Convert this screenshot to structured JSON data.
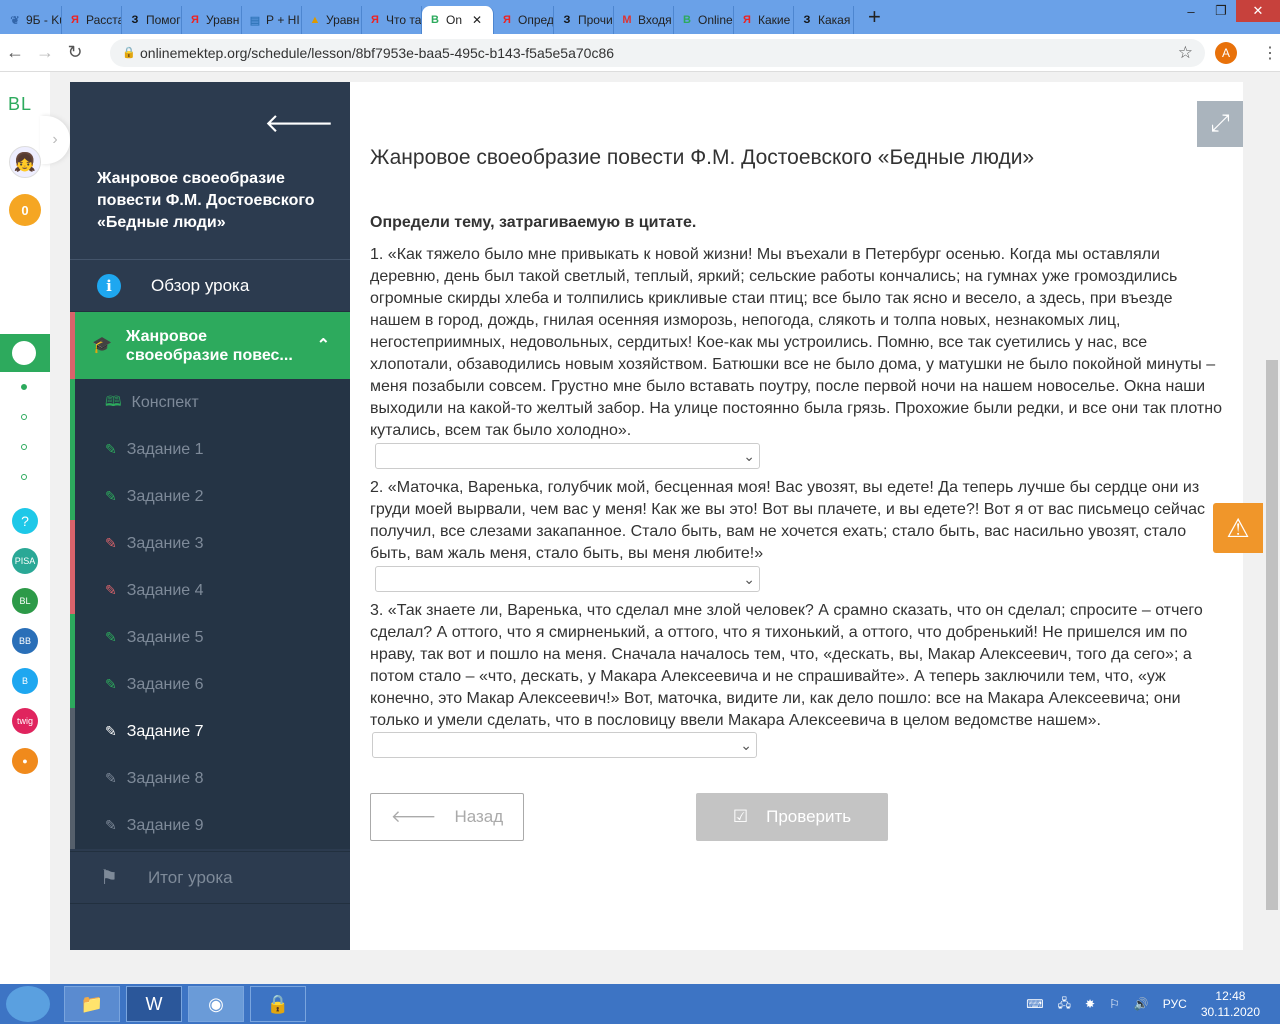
{
  "browser": {
    "tabs": [
      {
        "label": "9Б - Ku",
        "icon": "leaf-icon"
      },
      {
        "label": "Расста",
        "icon": "yandex-icon"
      },
      {
        "label": "Помог",
        "icon": "znanija-icon"
      },
      {
        "label": "Уравн",
        "icon": "yandex-icon"
      },
      {
        "label": "Р + НІ",
        "icon": "book-icon"
      },
      {
        "label": "Уравн",
        "icon": "image-icon"
      },
      {
        "label": "Что та",
        "icon": "yandex-icon"
      },
      {
        "label": "On",
        "icon": "onlinemektep-icon",
        "active": true
      },
      {
        "label": "Опред",
        "icon": "yandex-icon"
      },
      {
        "label": "Прочи",
        "icon": "znanija-icon"
      },
      {
        "label": "Входя",
        "icon": "gmail-icon"
      },
      {
        "label": "Online",
        "icon": "onlinemektep-icon"
      },
      {
        "label": "Какие",
        "icon": "yandex-icon"
      },
      {
        "label": "Какая",
        "icon": "znanija-icon"
      }
    ],
    "url": "onlinemektep.org/schedule/lesson/8bf7953e-baa5-495c-b143-f5a5e5a70c86",
    "profile": "A"
  },
  "rail": {
    "logo": "BL",
    "points": "0"
  },
  "sidebar": {
    "title": "Жанровое своеобразие повести Ф.М. Достоевского «Бедные люди»",
    "overview": "Обзор урока",
    "topic": "Жанровое своеобразие повес...",
    "items": [
      {
        "label": "Конспект",
        "status": "green",
        "icon": "book-icon"
      },
      {
        "label": "Задание 1",
        "status": "green"
      },
      {
        "label": "Задание 2",
        "status": "green"
      },
      {
        "label": "Задание 3",
        "status": "red"
      },
      {
        "label": "Задание 4",
        "status": "red"
      },
      {
        "label": "Задание 5",
        "status": "green"
      },
      {
        "label": "Задание 6",
        "status": "green"
      },
      {
        "label": "Задание 7",
        "status": "current"
      },
      {
        "label": "Задание 8",
        "status": "gray"
      },
      {
        "label": "Задание 9",
        "status": "gray"
      }
    ],
    "final": "Итог урока"
  },
  "main": {
    "title": "Жанровое своеобразие повести Ф.М. Достоевского «Бедные люди»",
    "task": "Определи тему, затрагиваемую в цитате.",
    "questions": [
      {
        "num": "1.",
        "text": "«Как тяжело было мне привыкать к новой жизни! Мы въехали в Петербург осенью. Когда мы оставляли деревню, день был такой светлый, теплый, яркий; сельские работы кончались; на гумнах уже громоздились огромные скирды хлеба и толпились крикливые стаи птиц; все было так ясно и весело, а здесь, при въезде нашем в город, дождь, гнилая осенняя изморозь, непогода, слякоть и толпа новых, незнакомых лиц, негостеприимных, недовольных, сердитых! Кое-как мы устроились. Помню, все так суетились у нас, все хлопотали, обзаводились новым хозяйством. Батюшки все не было дома, у матушки не было покойной минуты – меня позабыли совсем. Грустно мне было вставать поутру, после первой ночи на нашем новоселье. Окна наши выходили на какой-то желтый забор. На улице постоянно была грязь. Прохожие были редки, и все они так плотно кутались, всем так было холодно».",
        "answer": ""
      },
      {
        "num": "2.",
        "text": "«Маточка, Варенька, голубчик мой, бесценная моя! Вас увозят, вы едете! Да теперь лучше бы сердце они из груди моей вырвали, чем вас у меня! Как же вы это! Вот вы плачете, и вы едете?! Вот я от вас письмецо сейчас получил, все слезами закапанное. Стало быть, вам не хочется ехать; стало быть, вас насильно увозят, стало быть, вам жаль меня, стало быть, вы меня любите!»",
        "answer": ""
      },
      {
        "num": "3.",
        "text": "«Так знаете ли, Варенька, что сделал мне злой человек? А срамно сказать, что он сделал; спросите – отчего сделал? А оттого, что я смирненький, а оттого, что я тихонький, а оттого, что добренький! Не пришелся им по нраву, так вот и пошло на меня. Сначала началось тем, что, «дескать, вы, Макар Алексеевич, того да сего»; а потом стало – «что, дескать, у Макара Алексеевича и не спрашивайте». А теперь заключили тем, что, «уж конечно, это Макар Алексеевич!» Вот, маточка, видите ли, как дело пошло: все на Макара Алексеевича; они только и умели сделать, что в пословицу ввели Макара Алексеевича в целом ведомстве нашем».",
        "answer": ""
      }
    ],
    "back": "Назад",
    "check": "Проверить"
  },
  "taskbar": {
    "lang": "РУС",
    "time": "12:48",
    "date": "30.11.2020"
  }
}
